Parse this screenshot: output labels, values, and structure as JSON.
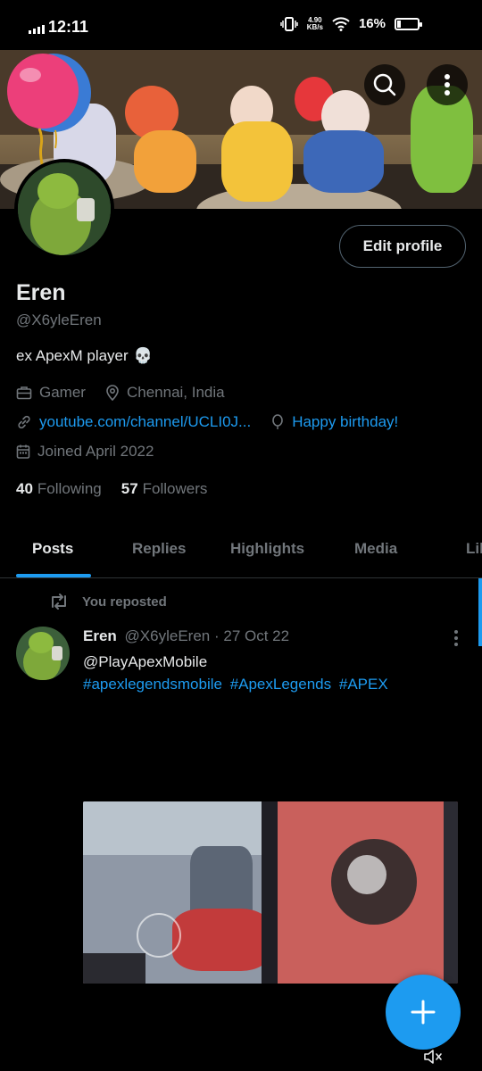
{
  "status": {
    "time": "12:11",
    "netspeed_value": "4.90",
    "netspeed_unit": "KB/s",
    "battery": "16%",
    "battery_level": 0.16
  },
  "profile": {
    "name": "Eren",
    "handle": "@X6yleEren",
    "bio": "ex ApexM player",
    "bio_emoji": "💀",
    "category": "Gamer",
    "location": "Chennai, India",
    "website": "youtube.com/channel/UCLI0J...",
    "birthday": "Happy birthday!",
    "joined": "Joined April 2022",
    "following_count": "40",
    "following_label": "Following",
    "followers_count": "57",
    "followers_label": "Followers",
    "edit_label": "Edit profile"
  },
  "tabs": [
    {
      "label": "Posts",
      "active": true
    },
    {
      "label": "Replies",
      "active": false
    },
    {
      "label": "Highlights",
      "active": false
    },
    {
      "label": "Media",
      "active": false
    },
    {
      "label": "Lil",
      "active": false
    }
  ],
  "post": {
    "repost_label": "You reposted",
    "author": "Eren",
    "handle": "@X6yleEren",
    "separator": "·",
    "date": "27 Oct 22",
    "mention": "@PlayApexMobile",
    "hashtags": [
      "#apexlegendsmobile",
      "#ApexLegends",
      "#APEX"
    ]
  },
  "colors": {
    "accent": "#1d9bf0",
    "background": "#000000",
    "secondary_text": "#71767b",
    "primary_text": "#e7e9ea"
  },
  "icons": {
    "search": "search-icon",
    "more": "more-vertical-icon",
    "compose": "plus-icon",
    "mute": "volume-mute-icon"
  }
}
